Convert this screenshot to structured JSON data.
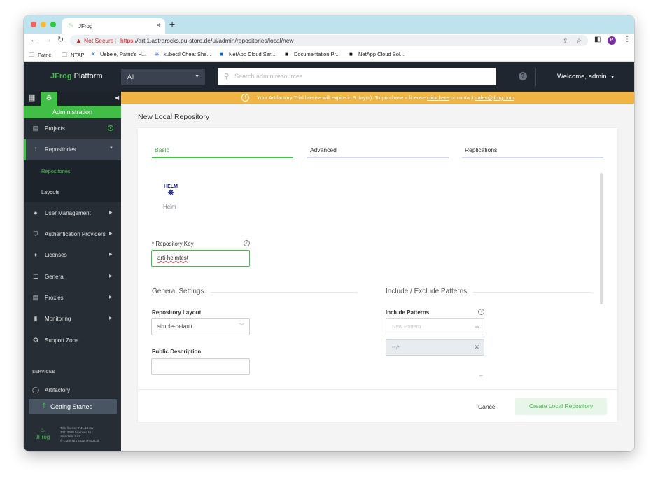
{
  "browser": {
    "tab_title": "JFrog",
    "tab_close": "×",
    "new_tab": "+",
    "not_secure": "Not Secure",
    "url_proto": "https:",
    "url_rest": "//arti1.astrarocks.pu-store.de/ui/admin/repositories/local/new",
    "profile_initial": "P",
    "bookmarks": [
      {
        "label": "Patric",
        "icon": "folder-icon"
      },
      {
        "label": "NTAP",
        "icon": "folder-icon"
      },
      {
        "label": "Uebele, Patric's H...",
        "icon": "confluence-icon"
      },
      {
        "label": "kubectl Cheat She...",
        "icon": "kubernetes-icon"
      },
      {
        "label": "NetApp Cloud Ser...",
        "icon": "netapp-icon"
      },
      {
        "label": "Documentation Pr...",
        "icon": "netapp-icon"
      },
      {
        "label": "NetApp Cloud Sol...",
        "icon": "netapp-icon"
      }
    ]
  },
  "header": {
    "brand_strong": "JFrog",
    "brand_rest": " Platform",
    "scope": "All",
    "search_placeholder": "Search admin resources",
    "help": "?",
    "welcome": "Welcome, admin"
  },
  "sidebar": {
    "section": "Administration",
    "items": [
      {
        "label": "Projects",
        "icon": "projects-icon"
      },
      {
        "label": "Repositories",
        "icon": "repositories-icon"
      },
      {
        "label": "User Management",
        "icon": "user-icon"
      },
      {
        "label": "Authentication Providers",
        "icon": "shield-icon"
      },
      {
        "label": "Licenses",
        "icon": "license-icon"
      },
      {
        "label": "General",
        "icon": "sliders-icon"
      },
      {
        "label": "Proxies",
        "icon": "server-icon"
      },
      {
        "label": "Monitoring",
        "icon": "bar-chart-icon"
      },
      {
        "label": "Support Zone",
        "icon": "lifebuoy-icon"
      },
      {
        "label": "Artifactory",
        "icon": "artifactory-icon"
      }
    ],
    "sub_items": [
      "Repositories",
      "Layouts"
    ],
    "services_label": "SERVICES",
    "getting_started": "Getting Started",
    "footer_logo": "JFrog",
    "footer_lines": [
      "Trial license 7.41.13 rev",
      "74113900 Licensed to",
      "Amadeus SAS",
      "© Copyright 2022 JFrog Ltd"
    ]
  },
  "banner": {
    "prefix": "Your Artifactory Trial license will expire in 3 day(s). To purchase a license ",
    "link1": "click here",
    "middle": " or contact ",
    "link2": "sales@jfrog.com",
    "suffix": "."
  },
  "page": {
    "title": "New Local Repository",
    "tabs": [
      "Basic",
      "Advanced",
      "Replications"
    ],
    "package_type": "Helm",
    "package_logo_text": "HELM",
    "repo_key_label": "* Repository Key",
    "repo_key_value": "arti-helmtest",
    "general_settings": "General Settings",
    "include_exclude": "Include / Exclude Patterns",
    "repo_layout_label": "Repository Layout",
    "repo_layout_value": "simple-default",
    "public_desc_label": "Public Description",
    "include_patterns_label": "Include Patterns",
    "new_pattern_placeholder": "New Pattern",
    "pattern_value": "**/*",
    "cancel": "Cancel",
    "create": "Create Local Repository"
  },
  "colors": {
    "accent": "#40be46",
    "header_bg": "#1f2630",
    "sidebar_bg": "#262d35",
    "banner": "#f0b444"
  }
}
